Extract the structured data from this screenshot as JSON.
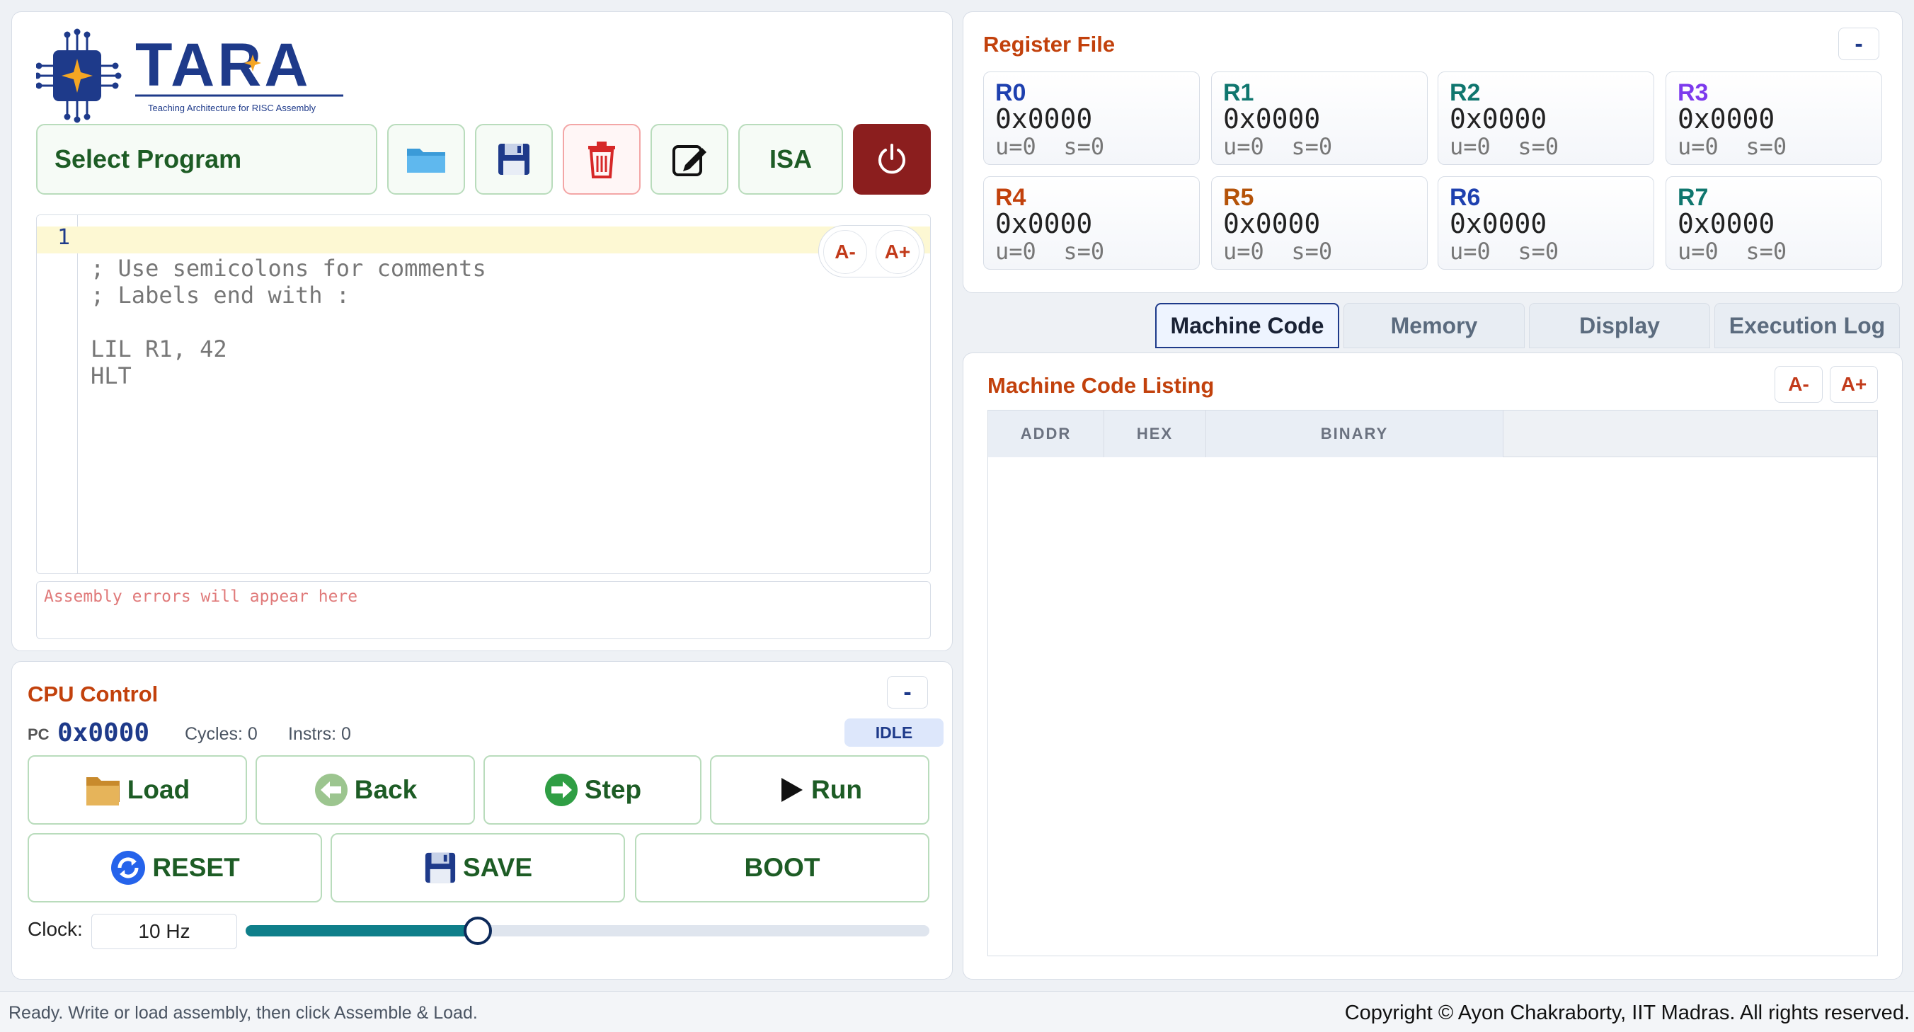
{
  "app": {
    "logo_title": "TARA",
    "logo_subtitle": "Teaching Architecture for RISC Assembly"
  },
  "toolbar": {
    "select_program": "Select Program",
    "isa_label": "ISA",
    "icons": [
      "folder-icon",
      "floppy-disk-icon",
      "trash-icon",
      "edit-icon",
      "power-icon"
    ]
  },
  "editor": {
    "line_number": "1",
    "code": "; Use semicolons for comments\n; Labels end with :\n\nLIL R1, 42\nHLT",
    "font_decrease": "A-",
    "font_increase": "A+",
    "error_placeholder": "Assembly errors will appear here"
  },
  "cpu": {
    "title": "CPU Control",
    "minimize": "-",
    "pc_label": "PC",
    "pc_value": "0x0000",
    "cycles": "Cycles: 0",
    "instrs": "Instrs: 0",
    "status": "IDLE",
    "buttons": {
      "load": "Load",
      "back": "Back",
      "step": "Step",
      "run": "Run",
      "reset": "RESET",
      "save": "SAVE",
      "boot": "BOOT"
    },
    "clock_label": "Clock:",
    "clock_value": "10 Hz",
    "clock_slider_fraction": 0.34
  },
  "registers": {
    "title": "Register File",
    "minimize": "-",
    "items": [
      {
        "name": "R0",
        "value": "0x0000",
        "flags": "u=0  s=0",
        "color": "#1e40af"
      },
      {
        "name": "R1",
        "value": "0x0000",
        "flags": "u=0  s=0",
        "color": "#0f766e"
      },
      {
        "name": "R2",
        "value": "0x0000",
        "flags": "u=0  s=0",
        "color": "#0f766e"
      },
      {
        "name": "R3",
        "value": "0x0000",
        "flags": "u=0  s=0",
        "color": "#7c3aed"
      },
      {
        "name": "R4",
        "value": "0x0000",
        "flags": "u=0  s=0",
        "color": "#c2410c"
      },
      {
        "name": "R5",
        "value": "0x0000",
        "flags": "u=0  s=0",
        "color": "#b45309"
      },
      {
        "name": "R6",
        "value": "0x0000",
        "flags": "u=0  s=0",
        "color": "#1e40af"
      },
      {
        "name": "R7",
        "value": "0x0000",
        "flags": "u=0  s=0",
        "color": "#0f766e"
      }
    ]
  },
  "tabs": [
    {
      "label": "Machine Code",
      "active": true
    },
    {
      "label": "Memory",
      "active": false
    },
    {
      "label": "Display",
      "active": false
    },
    {
      "label": "Execution Log",
      "active": false
    }
  ],
  "machine_code": {
    "title": "Machine Code Listing",
    "font_decrease": "A-",
    "font_increase": "A+",
    "columns": [
      "ADDR",
      "HEX",
      "BINARY"
    ]
  },
  "footer": {
    "status": "Ready. Write or load assembly, then click Assemble & Load.",
    "copyright": "Copyright © Ayon Chakraborty, IIT Madras. All rights reserved."
  },
  "colors": {
    "accent_green": "#1d5c25",
    "accent_orange": "#c2410c",
    "navy": "#1e3a8a",
    "power_red": "#8b1e1e"
  }
}
